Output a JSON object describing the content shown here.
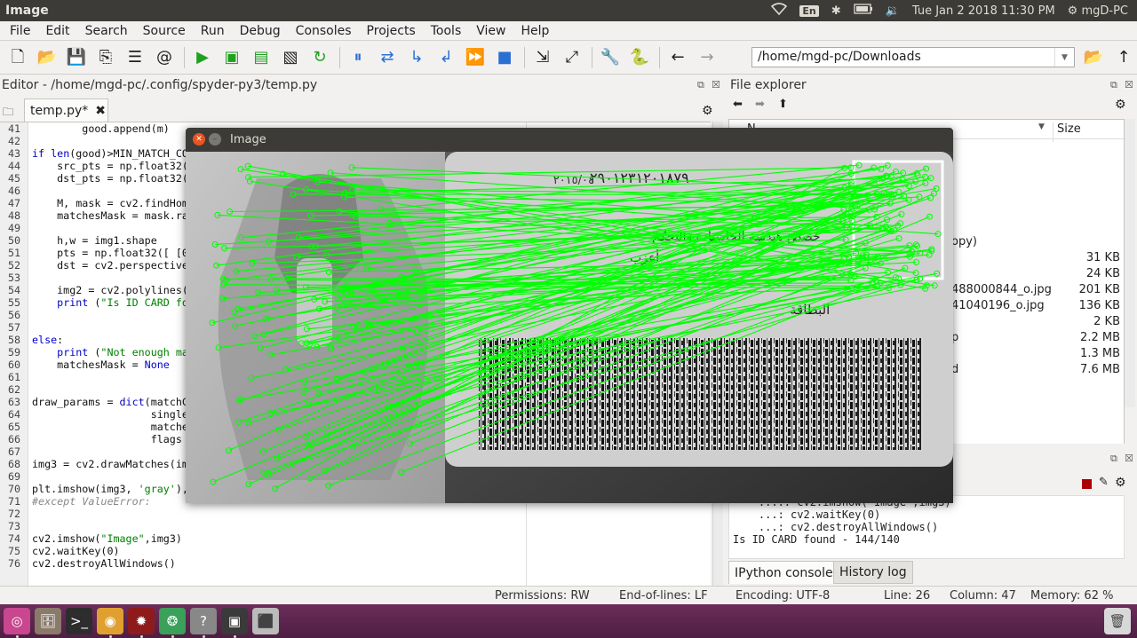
{
  "topbar": {
    "app_title": "Image",
    "lang": "En",
    "datetime": "Tue Jan  2 2018 11:30 PM",
    "user": "mgD-PC"
  },
  "menu": [
    "File",
    "Edit",
    "Search",
    "Source",
    "Run",
    "Debug",
    "Consoles",
    "Projects",
    "Tools",
    "View",
    "Help"
  ],
  "toolbar": {
    "path": "/home/mgd-pc/Downloads"
  },
  "editor": {
    "title": "Editor - /home/mgd-pc/.config/spyder-py3/temp.py",
    "tab": "temp.py*",
    "lines": [
      {
        "n": "41",
        "t": "        good.append(m)"
      },
      {
        "n": "42",
        "t": ""
      },
      {
        "n": "43",
        "t": "if len(good)>MIN_MATCH_COUNT:"
      },
      {
        "n": "44",
        "t": "    src_pts = np.float32([ kp1[m.queryIdx].pt for m in good ]).reshape(-1,1,2)"
      },
      {
        "n": "45",
        "t": "    dst_pts = np.float32([ kp2[m.trainIdx].pt for m in good ]).reshape(-1,1,2)"
      },
      {
        "n": "46",
        "t": ""
      },
      {
        "n": "47",
        "t": "    M, mask = cv2.findHomography(src_pts, dst_pts, cv2.RANSAC,5.0)"
      },
      {
        "n": "48",
        "t": "    matchesMask = mask.ravel().tolist()"
      },
      {
        "n": "49",
        "t": ""
      },
      {
        "n": "50",
        "t": "    h,w = img1.shape"
      },
      {
        "n": "51",
        "t": "    pts = np.float32([ [0,0],[0,h-1],[w-1,h-1],[w-1,0] ]).reshape(-1,1,2)"
      },
      {
        "n": "52",
        "t": "    dst = cv2.perspectiveTransform(pts,M)"
      },
      {
        "n": "53",
        "t": ""
      },
      {
        "n": "54",
        "t": "    img2 = cv2.polylines(img2,[np.int32(dst)],True,255,3, cv2.LINE_AA)"
      },
      {
        "n": "55",
        "t": "    print (\"Is ID CARD found - %d/%d\" % (len(good),MIN_MATCH_COUNT))"
      },
      {
        "n": "56",
        "t": ""
      },
      {
        "n": "57",
        "t": ""
      },
      {
        "n": "58",
        "t": "else:"
      },
      {
        "n": "59",
        "t": "    print (\"Not enough matches are found - %d/%d\" % (len(good),MIN_MATCH_COUNT))"
      },
      {
        "n": "60",
        "t": "    matchesMask = None"
      },
      {
        "n": "61",
        "t": ""
      },
      {
        "n": "62",
        "t": ""
      },
      {
        "n": "63",
        "t": "draw_params = dict(matchColor = (0,255,0),"
      },
      {
        "n": "64",
        "t": "                   singlePointColor = None,"
      },
      {
        "n": "65",
        "t": "                   matchesMask = matchesMask,"
      },
      {
        "n": "66",
        "t": "                   flags = 2)"
      },
      {
        "n": "67",
        "t": ""
      },
      {
        "n": "68",
        "t": "img3 = cv2.drawMatches(img1,kp1,img2,kp2,good,None,**draw_params)"
      },
      {
        "n": "69",
        "t": ""
      },
      {
        "n": "70",
        "t": "plt.imshow(img3, 'gray'),plt.show()"
      },
      {
        "n": "71",
        "t": "#except ValueError:"
      },
      {
        "n": "72",
        "t": ""
      },
      {
        "n": "73",
        "t": ""
      },
      {
        "n": "74",
        "t": "cv2.imshow(\"Image\",img3)"
      },
      {
        "n": "75",
        "t": "cv2.waitKey(0)"
      },
      {
        "n": "76",
        "t": "cv2.destroyAllWindows()"
      }
    ]
  },
  "file_explorer": {
    "title": "File explorer",
    "col_name": "N",
    "col_size": "Size",
    "rows": [
      {
        "name": "",
        "size": ""
      },
      {
        "name": "",
        "size": ""
      },
      {
        "name": "",
        "size": ""
      },
      {
        "name": "",
        "size": ""
      },
      {
        "name": "",
        "size": ""
      },
      {
        "name": "",
        "size": ""
      },
      {
        "name": "opy)",
        "size": ""
      },
      {
        "name": "",
        "size": "31 KB"
      },
      {
        "name": "",
        "size": "24 KB"
      },
      {
        "name": "488000844_o.jpg",
        "size": "201 KB"
      },
      {
        "name": "41040196_o.jpg",
        "size": "136 KB"
      },
      {
        "name": "",
        "size": "2 KB"
      },
      {
        "name": "p",
        "size": "2.2 MB"
      },
      {
        "name": "",
        "size": "1.3 MB"
      },
      {
        "name": "d",
        "size": "7.6 MB"
      }
    ]
  },
  "console": {
    "lines": [
      "    ....: cv2.imshow(\"Image\",img3)",
      "    ...: cv2.waitKey(0)",
      "    ...: cv2.destroyAllWindows()",
      "Is ID CARD found - 144/140"
    ],
    "tab_active": "IPython console",
    "tab_other": "History log"
  },
  "status": {
    "permissions": "Permissions: RW",
    "eol": "End-of-lines: LF",
    "encoding": "Encoding: UTF-8",
    "line": "Line: 26",
    "column": "Column: 47",
    "memory": "Memory:  62 %"
  },
  "image_window": {
    "title": "Image",
    "card_text_top": "٢٩٠١٢٣١٢٠١٨٧٩",
    "card_text_date": "٢٠١٥/٠٤",
    "card_text_line1": "خصص هندسة الحاسبات والتحكم",
    "card_text_line2": "أعزب",
    "card_text_line3": "البطاقة",
    "match_color": "#00ff00"
  }
}
